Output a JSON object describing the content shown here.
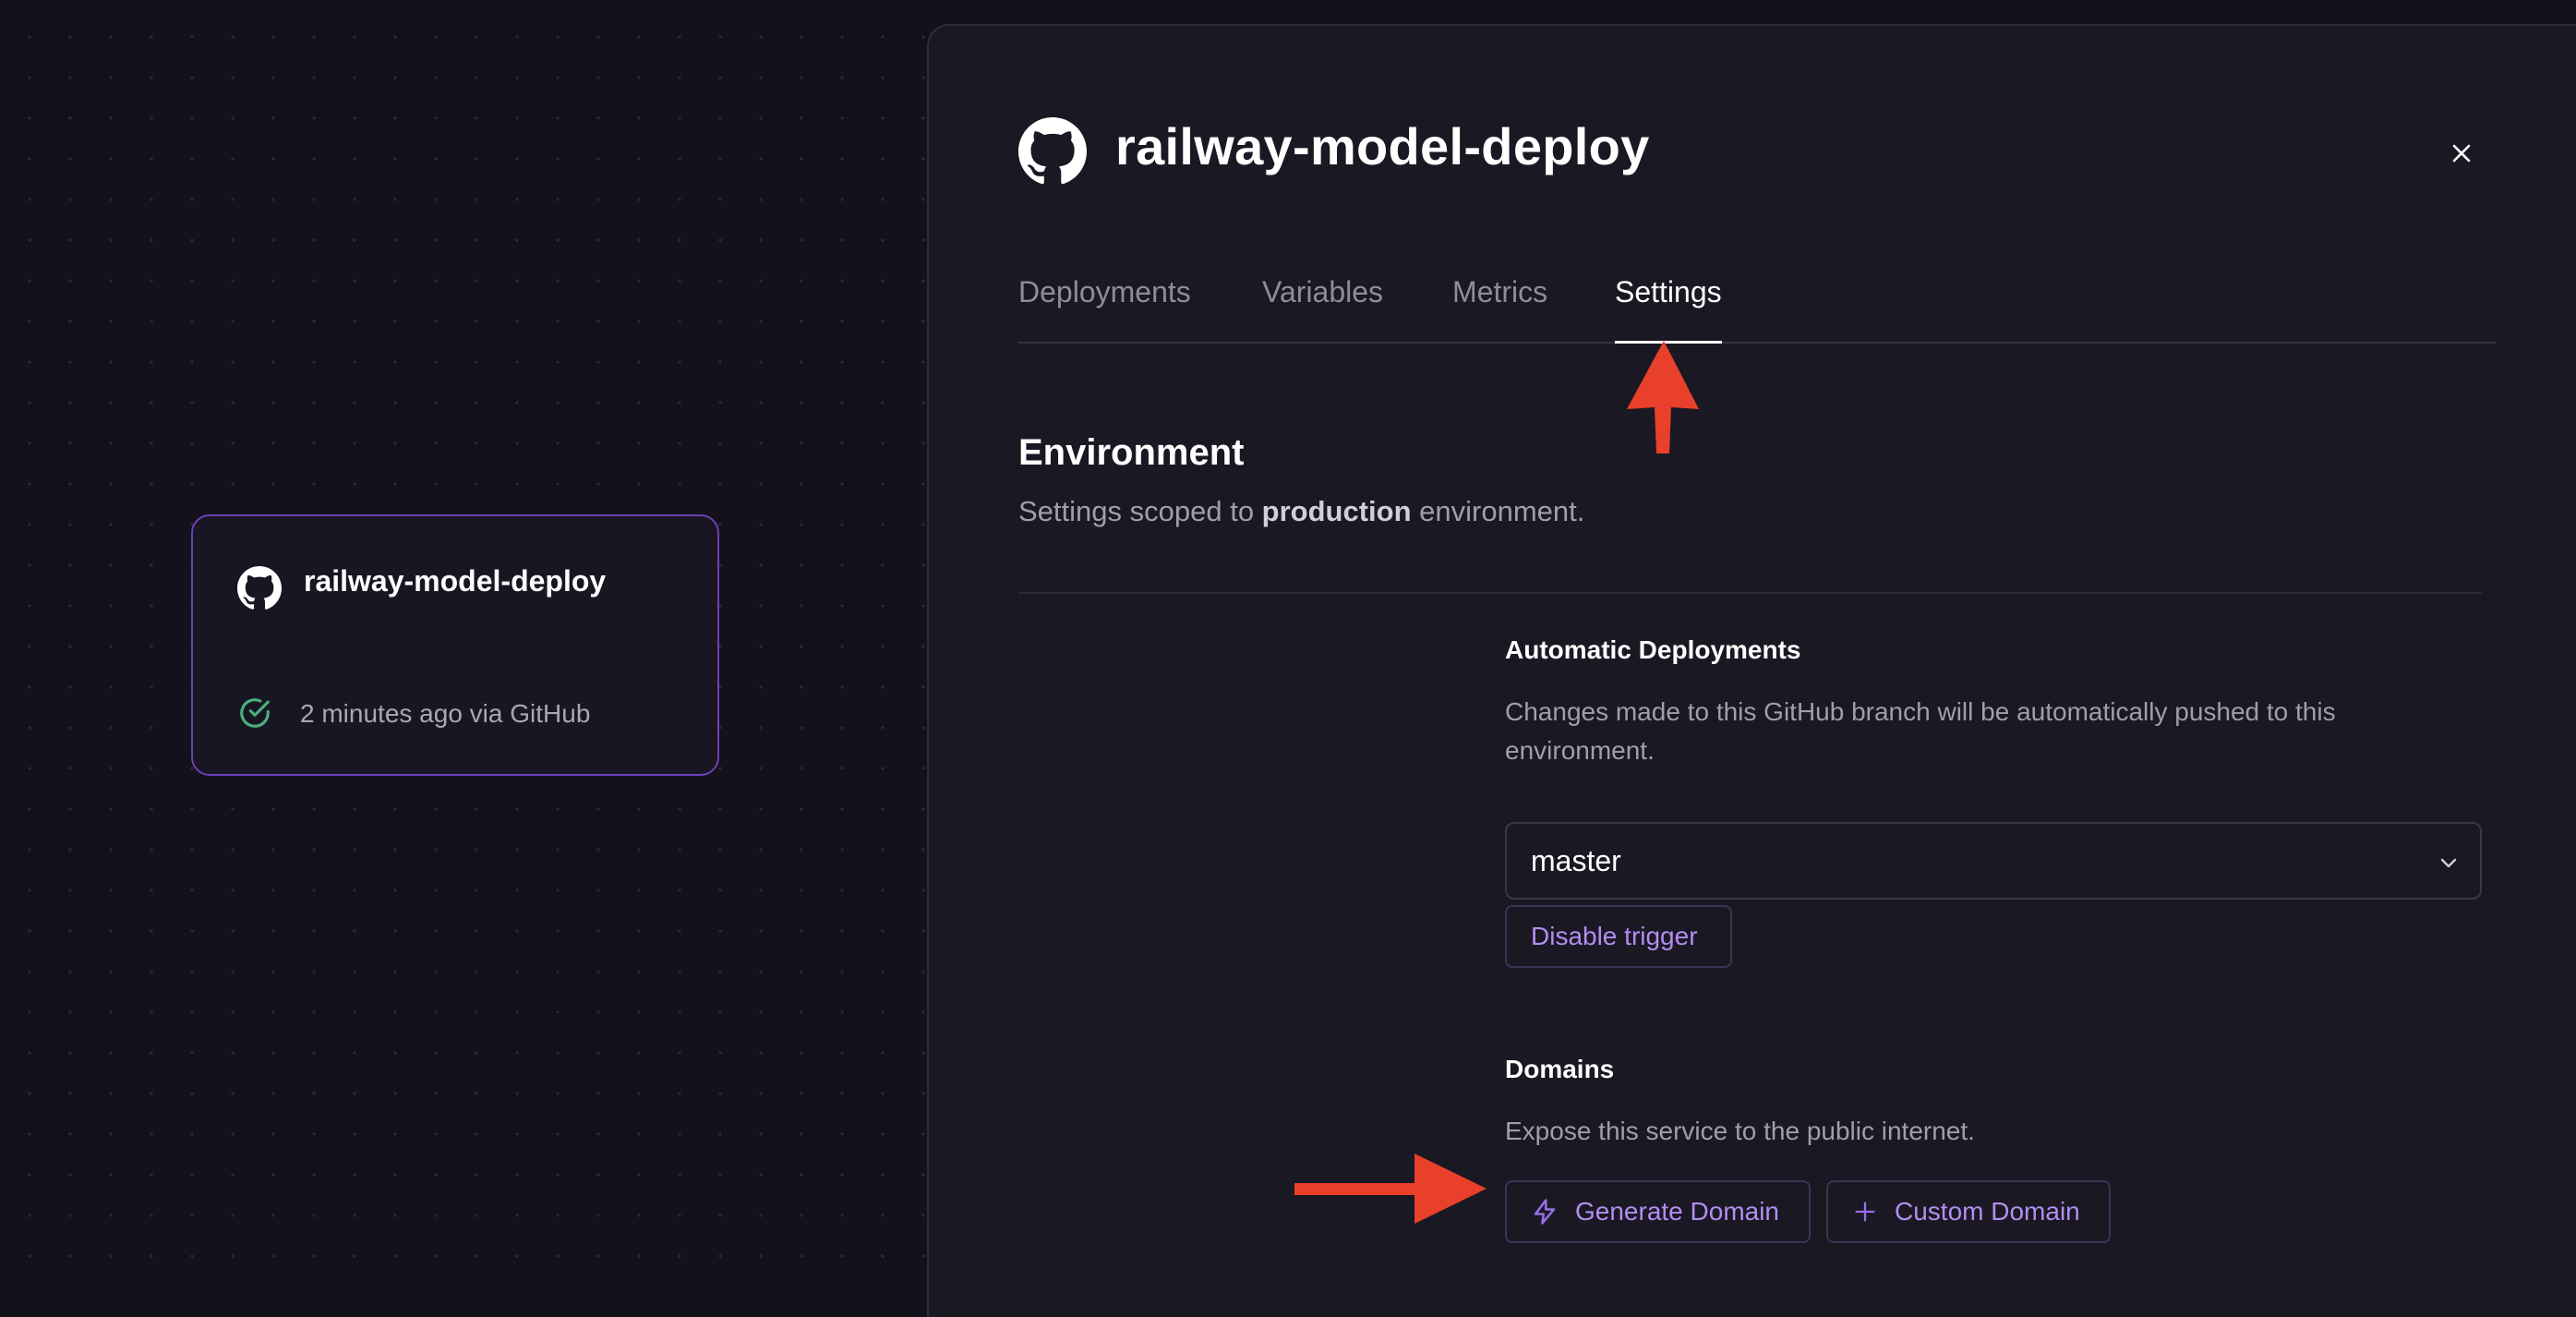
{
  "canvas": {
    "service_card": {
      "title": "railway-model-deploy",
      "status": "2 minutes ago via GitHub",
      "status_color": "#4caf7d"
    }
  },
  "panel": {
    "title": "railway-model-deploy",
    "tabs": [
      {
        "label": "Deployments",
        "active": false
      },
      {
        "label": "Variables",
        "active": false
      },
      {
        "label": "Metrics",
        "active": false
      },
      {
        "label": "Settings",
        "active": true
      }
    ],
    "environment": {
      "title": "Environment",
      "desc_prefix": "Settings scoped to ",
      "env_name": "production",
      "desc_suffix": " environment."
    },
    "automatic_deployments": {
      "title": "Automatic Deployments",
      "desc": "Changes made to this GitHub branch will be automatically pushed to this environment.",
      "branch": "master",
      "disable_button": "Disable trigger"
    },
    "domains": {
      "title": "Domains",
      "desc": "Expose this service to the public internet.",
      "generate_button": "Generate Domain",
      "custom_button": "Custom Domain"
    }
  },
  "annotations": {
    "arrow_color": "#e8402a"
  },
  "colors": {
    "accent": "#b28ef0",
    "card_border": "#6b40b8",
    "background": "#13111c"
  }
}
